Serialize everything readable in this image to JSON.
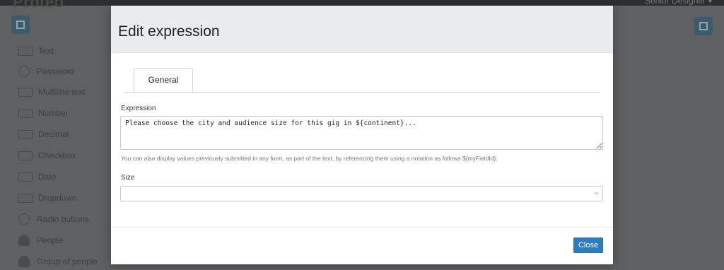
{
  "background": {
    "brand": "Proteo",
    "top_right": "Senior Designer ▾",
    "sidebar": [
      {
        "label": "Text",
        "icon": "textbox-icon"
      },
      {
        "label": "Password",
        "icon": "lock-icon"
      },
      {
        "label": "Multiline text",
        "icon": "textarea-icon"
      },
      {
        "label": "Number",
        "icon": "number-icon"
      },
      {
        "label": "Decimal",
        "icon": "decimal-icon"
      },
      {
        "label": "Checkbox",
        "icon": "checkbox-icon"
      },
      {
        "label": "Date",
        "icon": "calendar-icon"
      },
      {
        "label": "Dropdown",
        "icon": "dropdown-icon"
      },
      {
        "label": "Radio buttons",
        "icon": "radio-icon"
      },
      {
        "label": "People",
        "icon": "person-icon"
      },
      {
        "label": "Group of people",
        "icon": "group-icon"
      }
    ]
  },
  "modal": {
    "title": "Edit expression",
    "tabs": [
      {
        "label": "General",
        "active": true
      }
    ],
    "expression": {
      "label": "Expression",
      "value": "Please choose the city and audience size for this gig in ${continent}...",
      "help": "You can also display values previously submitted in any form, as part of the text, by referencing them using a notation as follows ${myFieldId}."
    },
    "size": {
      "label": "Size",
      "value": ""
    },
    "close_label": "Close"
  },
  "colors": {
    "primary_button": "#2e7cbb",
    "header_bg": "#e9ecee",
    "overlay": "#5f6062"
  }
}
